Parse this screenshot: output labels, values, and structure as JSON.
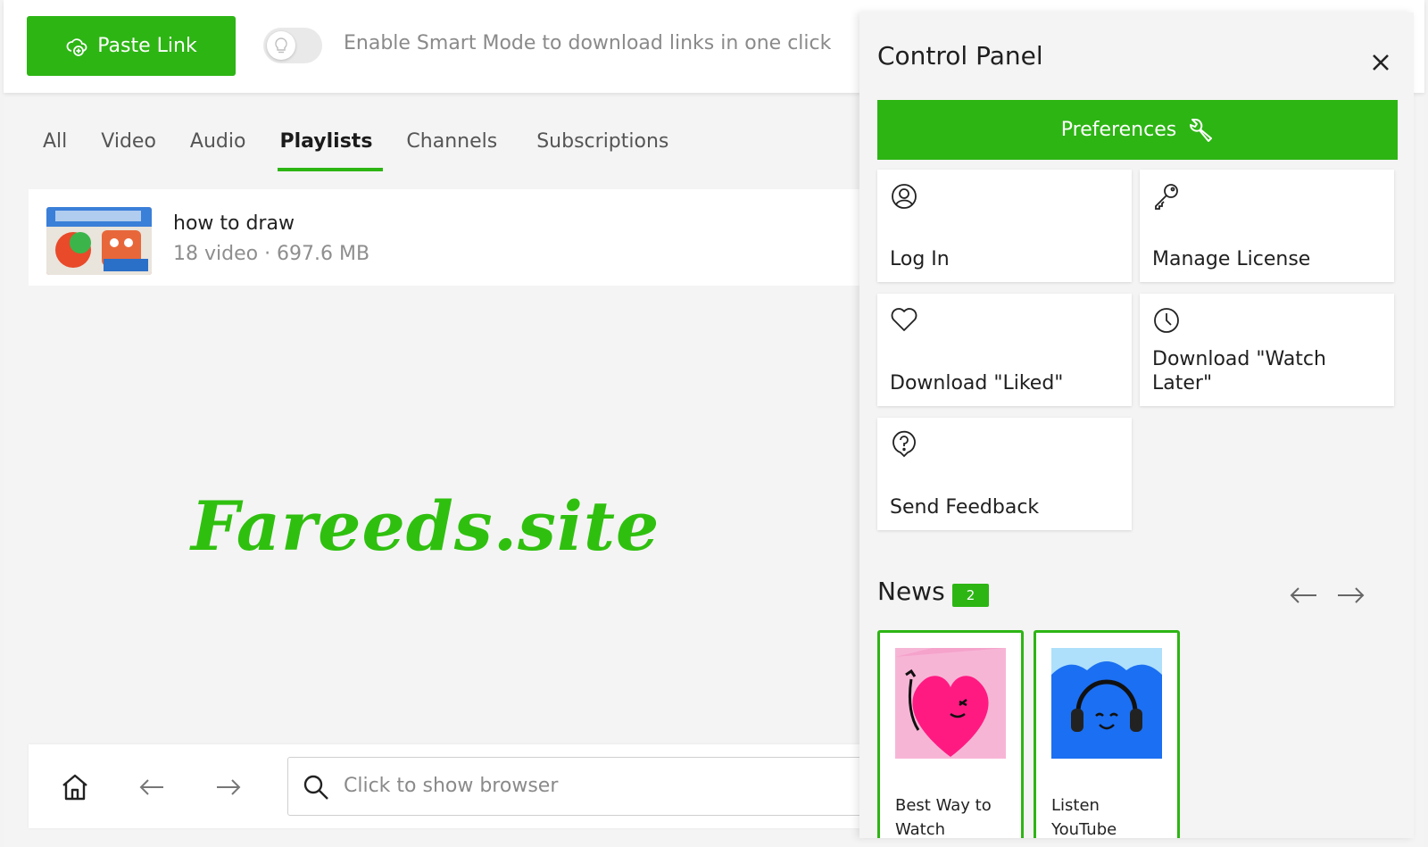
{
  "topbar": {
    "paste_label": "Paste Link",
    "smart_mode_text": "Enable Smart Mode to download links in one click"
  },
  "tabs": [
    {
      "label": "All",
      "active": false
    },
    {
      "label": "Video",
      "active": false
    },
    {
      "label": "Audio",
      "active": false
    },
    {
      "label": "Playlists",
      "active": true
    },
    {
      "label": "Channels",
      "active": false
    },
    {
      "label": "Subscriptions",
      "active": false
    }
  ],
  "playlist": {
    "title": "how to draw",
    "meta": "18 video · 697.6 MB"
  },
  "watermark": "Fareeds.site",
  "bottombar": {
    "search_placeholder": "Click to show browser"
  },
  "panel": {
    "title": "Control Panel",
    "preferences_label": "Preferences",
    "tiles": [
      {
        "label": "Log In",
        "icon": "user-circle-icon"
      },
      {
        "label": "Manage License",
        "icon": "key-icon"
      },
      {
        "label": "Download \"Liked\"",
        "icon": "heart-icon"
      },
      {
        "label": "Download \"Watch Later\"",
        "icon": "clock-icon"
      },
      {
        "label": "Send Feedback",
        "icon": "question-bubble-icon"
      }
    ],
    "news": {
      "title": "News",
      "count": "2",
      "cards": [
        {
          "text": "Best Way to Watch",
          "image": "pink-heart-character"
        },
        {
          "text": "Listen YouTube",
          "image": "blue-headphones-character"
        }
      ]
    }
  },
  "colors": {
    "accent": "#2db514",
    "background": "#f4f4f4",
    "muted_text": "#8a8a8a"
  }
}
